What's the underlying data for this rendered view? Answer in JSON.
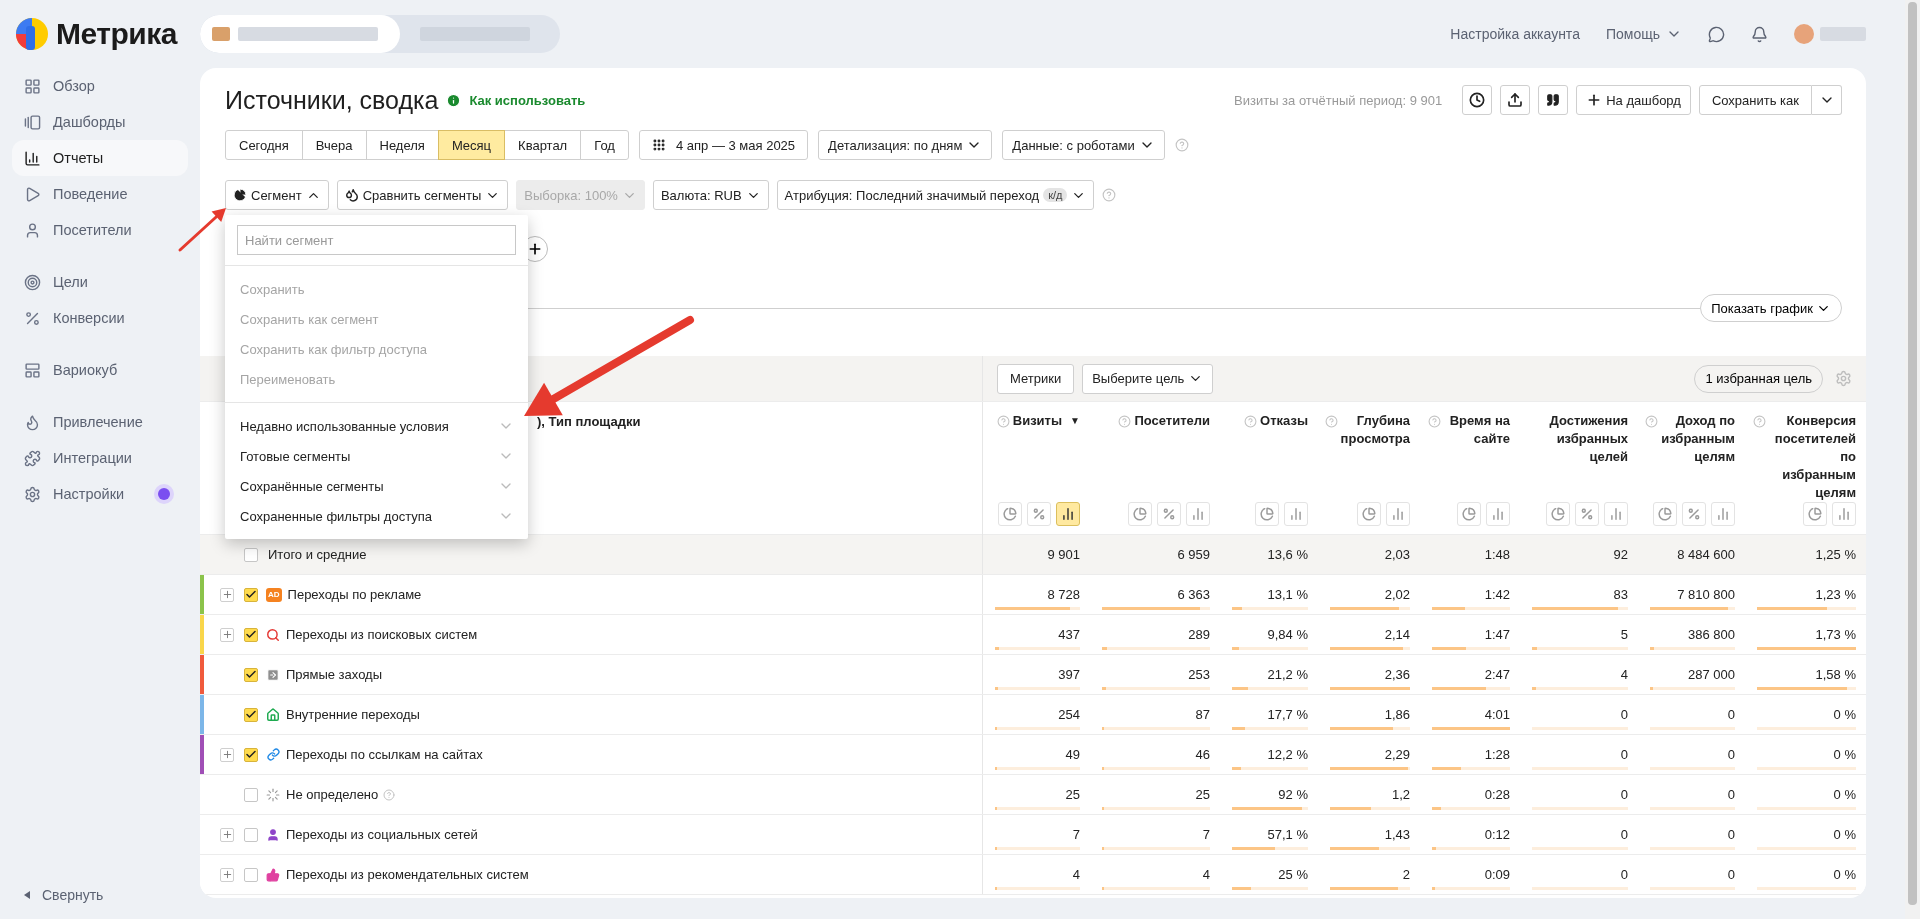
{
  "app": {
    "logo": "Метрика"
  },
  "sidebar": {
    "groups": [
      {
        "items": [
          {
            "label": "Обзор",
            "selected": false,
            "notification": false
          },
          {
            "label": "Дашборды",
            "selected": false,
            "notification": false
          },
          {
            "label": "Отчеты",
            "selected": true,
            "notification": false
          },
          {
            "label": "Поведение",
            "selected": false,
            "notification": false
          },
          {
            "label": "Посетители",
            "selected": false,
            "notification": false
          }
        ]
      },
      {
        "items": [
          {
            "label": "Цели",
            "selected": false,
            "notification": false
          },
          {
            "label": "Конверсии",
            "selected": false,
            "notification": false
          }
        ]
      },
      {
        "items": [
          {
            "label": "Вариокуб",
            "selected": false,
            "notification": false
          }
        ]
      },
      {
        "items": [
          {
            "label": "Привлечение",
            "selected": false,
            "notification": false
          },
          {
            "label": "Интеграции",
            "selected": false,
            "notification": false
          },
          {
            "label": "Настройки",
            "selected": false,
            "notification": true
          }
        ]
      }
    ],
    "collapse": "Свернуть"
  },
  "top_bar": {
    "account_settings": "Настройка аккаунта",
    "help": "Помощь"
  },
  "report": {
    "title": "Источники, сводка",
    "help_link": "Как использовать",
    "visits_summary": "Визиты за отчётный период: 9 901",
    "add_to_dashboard": "На дашборд",
    "save_as": "Сохранить как"
  },
  "periods": [
    {
      "label": "Сегодня",
      "selected": false
    },
    {
      "label": "Вчера",
      "selected": false
    },
    {
      "label": "Неделя",
      "selected": false
    },
    {
      "label": "Месяц",
      "selected": true
    },
    {
      "label": "Квартал",
      "selected": false
    },
    {
      "label": "Год",
      "selected": false
    }
  ],
  "date_range": "4 апр — 3 мая 2025",
  "filters": [
    {
      "label": "Детализация: по дням",
      "help": false
    },
    {
      "label": "Данные: с роботами",
      "help": true
    }
  ],
  "segment_bar": [
    {
      "label": "Сегмент",
      "kind": "pie",
      "expanded": true,
      "disabled": false
    },
    {
      "label": "Сравнить сегменты",
      "kind": "drops",
      "expanded": false,
      "disabled": false
    },
    {
      "label": "Выборка: 100%",
      "kind": "plain",
      "expanded": false,
      "disabled": true
    },
    {
      "label": "Валюта: RUB",
      "kind": "plain",
      "expanded": false,
      "disabled": false
    },
    {
      "label": "Атрибуция: Последний значимый переход",
      "kind": "plain",
      "tag": "к/д",
      "expanded": false,
      "disabled": false,
      "help": true
    }
  ],
  "chart_toggle": "Показать график",
  "segment_menu": {
    "search": {
      "placeholder": "Найти сегмент"
    },
    "actions": [
      {
        "label": "Сохранить",
        "disabled": true
      },
      {
        "label": "Сохранить как сегмент",
        "disabled": true
      },
      {
        "label": "Сохранить как фильтр доступа",
        "disabled": true
      },
      {
        "label": "Переименовать",
        "disabled": true
      }
    ],
    "sections": [
      {
        "label": "Недавно использованные условия",
        "expanded": false
      },
      {
        "label": "Готовые сегменты",
        "expanded": false
      },
      {
        "label": "Сохранённые сегменты",
        "expanded": false
      },
      {
        "label": "Сохраненные фильтры доступа",
        "expanded": false
      }
    ]
  },
  "table": {
    "toolbar": {
      "metrics": "Метрики",
      "goal": "Выберите цель",
      "favorites": "1 избранная цель"
    },
    "dimension_header": "), Тип площадки",
    "columns": [
      {
        "label": "Визиты",
        "help": true,
        "sort_mark": "▼",
        "views": [
          {
            "kind": "pie",
            "selected": false
          },
          {
            "kind": "percent",
            "selected": false
          },
          {
            "kind": "bars",
            "selected": true
          }
        ]
      },
      {
        "label": "Посетители",
        "help": true,
        "views": [
          {
            "kind": "pie",
            "selected": false
          },
          {
            "kind": "percent",
            "selected": false
          },
          {
            "kind": "bars",
            "selected": false
          }
        ]
      },
      {
        "label": "Отказы",
        "help": true,
        "views": [
          {
            "kind": "pie",
            "selected": false
          },
          {
            "kind": "bars",
            "selected": false
          }
        ]
      },
      {
        "label": "Глубина просмотра",
        "help": true,
        "views": [
          {
            "kind": "pie",
            "selected": false
          },
          {
            "kind": "bars",
            "selected": false
          }
        ]
      },
      {
        "label": "Время на сайте",
        "help": true,
        "views": [
          {
            "kind": "pie",
            "selected": false
          },
          {
            "kind": "bars",
            "selected": false
          }
        ]
      },
      {
        "label": "Достижения избранных целей",
        "help": false,
        "views": [
          {
            "kind": "pie",
            "selected": false
          },
          {
            "kind": "percent",
            "selected": false
          },
          {
            "kind": "bars",
            "selected": false
          }
        ]
      },
      {
        "label": "Доход по избранным целям",
        "help": true,
        "views": [
          {
            "kind": "pie",
            "selected": false
          },
          {
            "kind": "percent",
            "selected": false
          },
          {
            "kind": "bars",
            "selected": false
          }
        ]
      },
      {
        "label": "Конверсия посетителей по избранным целям",
        "help": true,
        "views": [
          {
            "kind": "pie",
            "selected": false
          },
          {
            "kind": "bars",
            "selected": false
          }
        ]
      }
    ],
    "totals": {
      "label": "Итого и средние",
      "checked": false,
      "cells": [
        "9 901",
        "6 959",
        "13,6 %",
        "2,03",
        "1:48",
        "92",
        "8 484 600",
        "1,25 %"
      ]
    },
    "rows": [
      {
        "label": "Переходы по рекламе",
        "checked": true,
        "expandable": true,
        "kind": "ad",
        "icon_label": "AD",
        "color": "#8bc34a",
        "cells": [
          {
            "text": "8 728",
            "level": 0.88
          },
          {
            "text": "6 363",
            "level": 0.91
          },
          {
            "text": "13,1 %",
            "level": 0.131
          },
          {
            "text": "2,02",
            "level": 0.86
          },
          {
            "text": "1:42",
            "level": 0.42
          },
          {
            "text": "83",
            "level": 0.9
          },
          {
            "text": "7 810 800",
            "level": 0.92
          },
          {
            "text": "1,23 %",
            "level": 0.71
          }
        ]
      },
      {
        "label": "Переходы из поисковых систем",
        "checked": true,
        "expandable": true,
        "kind": "search",
        "color": "#f9d64a",
        "cells": [
          {
            "text": "437",
            "level": 0.044
          },
          {
            "text": "289",
            "level": 0.042
          },
          {
            "text": "9,84 %",
            "level": 0.098
          },
          {
            "text": "2,14",
            "level": 0.91
          },
          {
            "text": "1:47",
            "level": 0.44
          },
          {
            "text": "5",
            "level": 0.054
          },
          {
            "text": "386 800",
            "level": 0.046
          },
          {
            "text": "1,73 %",
            "level": 1
          }
        ]
      },
      {
        "label": "Прямые заходы",
        "checked": true,
        "expandable": false,
        "kind": "direct",
        "color": "#f05a3c",
        "cells": [
          {
            "text": "397",
            "level": 0.04
          },
          {
            "text": "253",
            "level": 0.036
          },
          {
            "text": "21,2 %",
            "level": 0.212
          },
          {
            "text": "2,36",
            "level": 1
          },
          {
            "text": "2:47",
            "level": 0.69
          },
          {
            "text": "4",
            "level": 0.043
          },
          {
            "text": "287 000",
            "level": 0.034
          },
          {
            "text": "1,58 %",
            "level": 0.91
          }
        ]
      },
      {
        "label": "Внутренние переходы",
        "checked": true,
        "expandable": false,
        "kind": "internal",
        "color": "#7cb6e8",
        "cells": [
          {
            "text": "254",
            "level": 0.026
          },
          {
            "text": "87",
            "level": 0.0125
          },
          {
            "text": "17,7 %",
            "level": 0.177
          },
          {
            "text": "1,86",
            "level": 0.79
          },
          {
            "text": "4:01",
            "level": 1
          },
          {
            "text": "0",
            "level": 0
          },
          {
            "text": "0",
            "level": 0
          },
          {
            "text": "0 %",
            "level": 0
          }
        ]
      },
      {
        "label": "Переходы по ссылкам на сайтах",
        "checked": true,
        "expandable": true,
        "kind": "link",
        "color": "#a04fb6",
        "cells": [
          {
            "text": "49",
            "level": 0.005
          },
          {
            "text": "46",
            "level": 0.0066
          },
          {
            "text": "12,2 %",
            "level": 0.122
          },
          {
            "text": "2,29",
            "level": 0.97
          },
          {
            "text": "1:28",
            "level": 0.37
          },
          {
            "text": "0",
            "level": 0
          },
          {
            "text": "0",
            "level": 0
          },
          {
            "text": "0 %",
            "level": 0
          }
        ]
      },
      {
        "label": "Не определено",
        "checked": false,
        "expandable": false,
        "kind": "undefined",
        "help": true,
        "cells": [
          {
            "text": "25",
            "level": 0.003
          },
          {
            "text": "25",
            "level": 0.0036
          },
          {
            "text": "92 %",
            "level": 0.92
          },
          {
            "text": "1,2",
            "level": 0.51
          },
          {
            "text": "0:28",
            "level": 0.12
          },
          {
            "text": "0",
            "level": 0
          },
          {
            "text": "0",
            "level": 0
          },
          {
            "text": "0 %",
            "level": 0
          }
        ]
      },
      {
        "label": "Переходы из социальных сетей",
        "checked": false,
        "expandable": true,
        "kind": "social",
        "cells": [
          {
            "text": "7",
            "level": 0.001
          },
          {
            "text": "7",
            "level": 0.001
          },
          {
            "text": "57,1 %",
            "level": 0.571
          },
          {
            "text": "1,43",
            "level": 0.61
          },
          {
            "text": "0:12",
            "level": 0.05
          },
          {
            "text": "0",
            "level": 0
          },
          {
            "text": "0",
            "level": 0
          },
          {
            "text": "0 %",
            "level": 0
          }
        ]
      },
      {
        "label": "Переходы из рекомендательных систем",
        "checked": false,
        "expandable": true,
        "kind": "recommend",
        "cells": [
          {
            "text": "4",
            "level": 0.0004
          },
          {
            "text": "4",
            "level": 0.0006
          },
          {
            "text": "25 %",
            "level": 0.25
          },
          {
            "text": "2",
            "level": 0.85
          },
          {
            "text": "0:09",
            "level": 0.04
          },
          {
            "text": "0",
            "level": 0
          },
          {
            "text": "0",
            "level": 0
          },
          {
            "text": "0 %",
            "level": 0
          }
        ]
      }
    ]
  }
}
